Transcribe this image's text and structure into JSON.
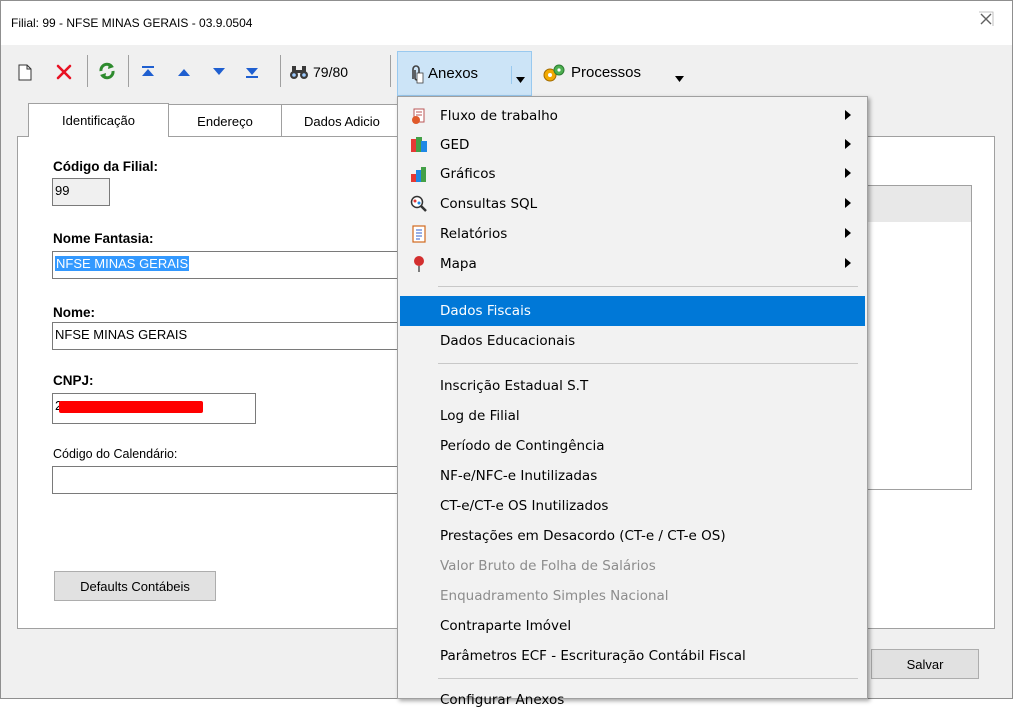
{
  "window": {
    "title": "Filial: 99 - NFSE MINAS GERAIS - 03.9.0504",
    "close_glyph": "⌧"
  },
  "toolbar": {
    "record_counter": "79/80",
    "anexos_label": "Anexos",
    "processos_label": "Processos"
  },
  "tabs": [
    {
      "label": "Identificação"
    },
    {
      "label": "Endereço"
    },
    {
      "label": "Dados Adicio"
    }
  ],
  "form": {
    "codigo_filial_label": "Código da Filial:",
    "codigo_filial_value": "99",
    "nome_fantasia_label": "Nome Fantasia:",
    "nome_fantasia_value": "NFSE MINAS GERAIS",
    "nome_label": "Nome:",
    "nome_value": "NFSE MINAS GERAIS",
    "cnpj_label": "CNPJ:",
    "cnpj_value": "2",
    "calendario_label": "Código do Calendário:",
    "calendario_value": "",
    "defaults_button": "Defaults Contábeis",
    "salvar_button": "Salvar"
  },
  "menu": {
    "items": [
      {
        "label": "Fluxo de trabalho",
        "icon": "workflow-icon",
        "submenu": true
      },
      {
        "label": "GED",
        "icon": "ged-icon",
        "submenu": true
      },
      {
        "label": "Gráficos",
        "icon": "bar-chart-icon",
        "submenu": true
      },
      {
        "label": "Consultas SQL",
        "icon": "sql-query-icon",
        "submenu": true
      },
      {
        "label": "Relatórios",
        "icon": "report-icon",
        "submenu": true
      },
      {
        "label": "Mapa",
        "icon": "map-pin-icon",
        "submenu": true
      },
      {
        "label": "Dados Fiscais",
        "highlighted": true
      },
      {
        "label": "Dados Educacionais"
      },
      {
        "label": "Inscrição Estadual S.T"
      },
      {
        "label": "Log de Filial"
      },
      {
        "label": "Período de Contingência"
      },
      {
        "label": "NF-e/NFC-e Inutilizadas"
      },
      {
        "label": "CT-e/CT-e OS Inutilizados"
      },
      {
        "label": "Prestações em Desacordo (CT-e / CT-e OS)"
      },
      {
        "label": "Valor Bruto de Folha de Salários",
        "disabled": true
      },
      {
        "label": "Enquadramento Simples Nacional",
        "disabled": true
      },
      {
        "label": "Contraparte Imóvel"
      },
      {
        "label": "Parâmetros ECF - Escrituração Contábil Fiscal"
      },
      {
        "label": "Configurar Anexos"
      }
    ]
  },
  "colors": {
    "highlight": "#0078d7",
    "selection": "#3399ff",
    "redaction": "#ff0000",
    "delete_x": "#e81123",
    "refresh": "#2e8b2e",
    "nav_arrows": "#1f5fd0"
  }
}
